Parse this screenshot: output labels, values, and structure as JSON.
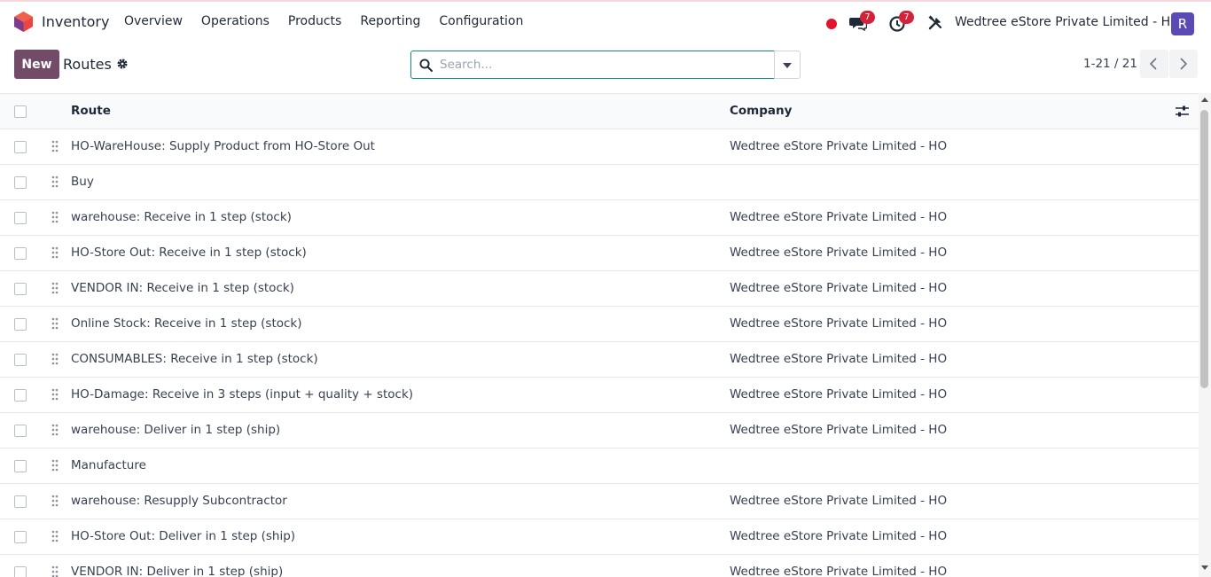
{
  "app": {
    "name": "Inventory"
  },
  "menu": [
    "Overview",
    "Operations",
    "Products",
    "Reporting",
    "Configuration"
  ],
  "systray": {
    "messages_count": "7",
    "activities_count": "7",
    "company": "Wedtree eStore Private Limited - HO",
    "avatar_initial": "R"
  },
  "control": {
    "new_label": "New",
    "title": "Routes",
    "search_placeholder": "Search...",
    "pager": "1-21 / 21"
  },
  "colors": {
    "brand": "#714b67",
    "badge": "#d0243c",
    "recording": "#e0142e",
    "avatar": "#5b4ab3",
    "search_border": "#0f8a8c"
  },
  "table": {
    "columns": {
      "route": "Route",
      "company": "Company"
    },
    "rows": [
      {
        "route": "HO-WareHouse: Supply Product from HO-Store Out",
        "company": "Wedtree eStore Private Limited - HO"
      },
      {
        "route": "Buy",
        "company": ""
      },
      {
        "route": "warehouse: Receive in 1 step (stock)",
        "company": "Wedtree eStore Private Limited - HO"
      },
      {
        "route": "HO-Store Out: Receive in 1 step (stock)",
        "company": "Wedtree eStore Private Limited - HO"
      },
      {
        "route": "VENDOR IN: Receive in 1 step (stock)",
        "company": "Wedtree eStore Private Limited - HO"
      },
      {
        "route": "Online Stock: Receive in 1 step (stock)",
        "company": "Wedtree eStore Private Limited - HO"
      },
      {
        "route": "CONSUMABLES: Receive in 1 step (stock)",
        "company": "Wedtree eStore Private Limited - HO"
      },
      {
        "route": "HO-Damage: Receive in 3 steps (input + quality + stock)",
        "company": "Wedtree eStore Private Limited - HO"
      },
      {
        "route": "warehouse: Deliver in 1 step (ship)",
        "company": "Wedtree eStore Private Limited - HO"
      },
      {
        "route": "Manufacture",
        "company": ""
      },
      {
        "route": "warehouse: Resupply Subcontractor",
        "company": "Wedtree eStore Private Limited - HO"
      },
      {
        "route": "HO-Store Out: Deliver in 1 step (ship)",
        "company": "Wedtree eStore Private Limited - HO"
      },
      {
        "route": "VENDOR IN: Deliver in 1 step (ship)",
        "company": "Wedtree eStore Private Limited - HO"
      }
    ]
  }
}
